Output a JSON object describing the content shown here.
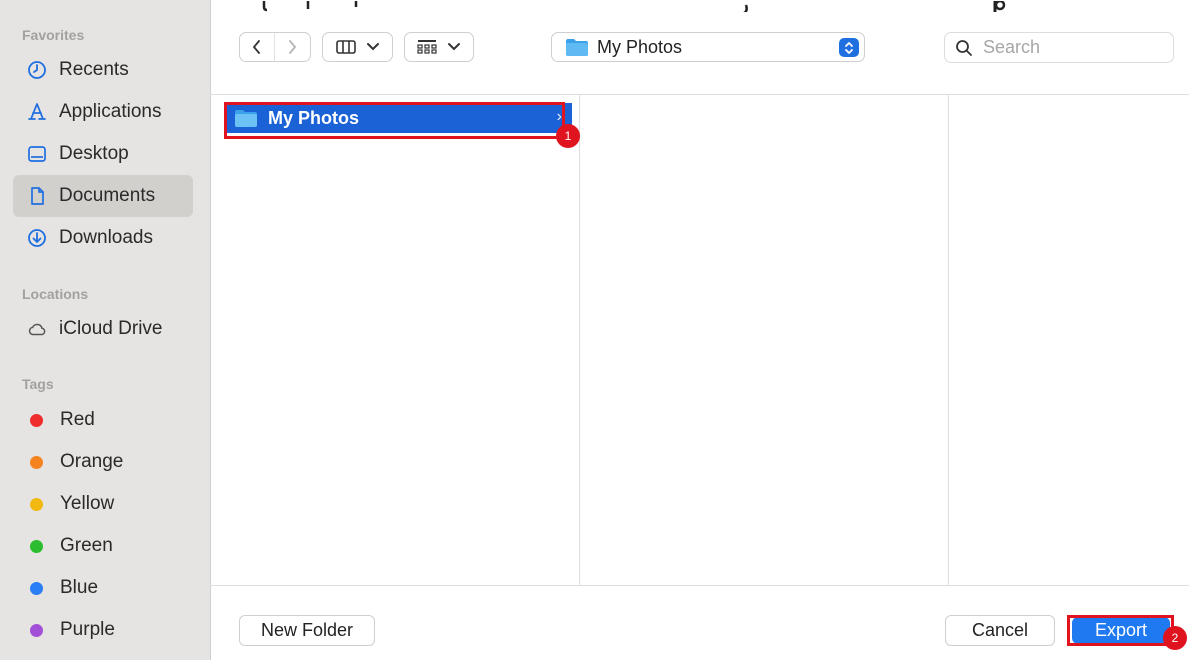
{
  "sidebar": {
    "favorites_title": "Favorites",
    "favorites": [
      {
        "label": "Recents",
        "icon": "clock-icon"
      },
      {
        "label": "Applications",
        "icon": "applications-icon"
      },
      {
        "label": "Desktop",
        "icon": "desktop-icon"
      },
      {
        "label": "Documents",
        "icon": "document-icon",
        "selected": true
      },
      {
        "label": "Downloads",
        "icon": "download-icon"
      }
    ],
    "locations_title": "Locations",
    "locations": [
      {
        "label": "iCloud Drive",
        "icon": "cloud-icon"
      }
    ],
    "tags_title": "Tags",
    "tags": [
      {
        "label": "Red",
        "color": "#ef2d2d"
      },
      {
        "label": "Orange",
        "color": "#f5831f"
      },
      {
        "label": "Yellow",
        "color": "#f2b913"
      },
      {
        "label": "Green",
        "color": "#2bbd2f"
      },
      {
        "label": "Blue",
        "color": "#2a7ef6"
      },
      {
        "label": "Purple",
        "color": "#a24fd8"
      }
    ]
  },
  "toolbar": {
    "back_icon": "chevron-left-icon",
    "forward_icon": "chevron-right-icon",
    "view_icon": "columns-view-icon",
    "group_icon": "grid-group-icon",
    "path_label": "My Photos",
    "search_placeholder": "Search"
  },
  "browser": {
    "column1_items": [
      {
        "label": "My Photos",
        "selected": true
      }
    ]
  },
  "annotations": {
    "badge1": "1",
    "badge2": "2",
    "highlight_color": "#e0141e"
  },
  "footer": {
    "new_folder_label": "New Folder",
    "cancel_label": "Cancel",
    "export_label": "Export"
  },
  "colors": {
    "accent": "#1f7af2",
    "selection": "#1a62d6",
    "sidebar_bg": "#e6e4e2"
  }
}
